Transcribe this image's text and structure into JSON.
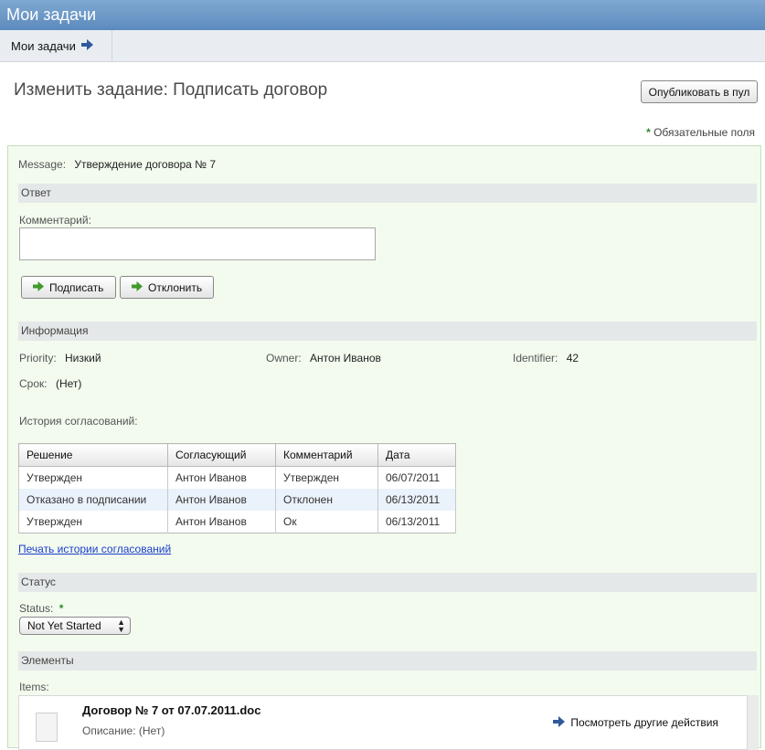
{
  "window": {
    "title": "Мои задачи"
  },
  "nav": {
    "item_label": "Мои задачи"
  },
  "page": {
    "title": "Изменить задание: Подписать договор",
    "publish_label": "Опубликовать в пул",
    "required_star": "*",
    "required_note": "Обязательные поля"
  },
  "message": {
    "label": "Message:",
    "value": "Утверждение договора № 7"
  },
  "response": {
    "section_title": "Ответ",
    "comment_label": "Комментарий:",
    "comment_value": "",
    "sign_label": "Подписать",
    "reject_label": "Отклонить"
  },
  "info": {
    "section_title": "Информация",
    "priority_label": "Priority:",
    "priority_value": "Низкий",
    "owner_label": "Owner:",
    "owner_value": "Антон Иванов",
    "identifier_label": "Identifier:",
    "identifier_value": "42",
    "due_label": "Срок:",
    "due_value": "(Нет)",
    "history_label": "История согласований:"
  },
  "history": {
    "headers": [
      "Решение",
      "Согласующий",
      "Комментарий",
      "Дата"
    ],
    "rows": [
      [
        "Утвержден",
        "Антон Иванов",
        "Утвержден",
        "06/07/2011"
      ],
      [
        "Отказано в подписании",
        "Антон Иванов",
        "Отклонен",
        "06/13/2011"
      ],
      [
        "Утвержден",
        "Антон Иванов",
        "Ок",
        "06/13/2011"
      ]
    ],
    "print_link": "Печать истории согласований"
  },
  "status": {
    "section_title": "Статус",
    "label": "Status:",
    "required_star": "*",
    "selected": "Not Yet Started"
  },
  "elements": {
    "section_title": "Элементы",
    "items_label": "Items:",
    "doc_title": "Договор № 7 от 07.07.2011.doc",
    "doc_desc_label": "Описание:",
    "doc_desc_value": "(Нет)",
    "other_actions": "Посмотреть другие действия"
  },
  "colors": {
    "titlebar": "#6b96c6",
    "panel_bg": "#f2fbee",
    "link": "#1a3ecf",
    "green_arrow": "#3f9a2c",
    "blue_arrow": "#2f5a9a"
  }
}
